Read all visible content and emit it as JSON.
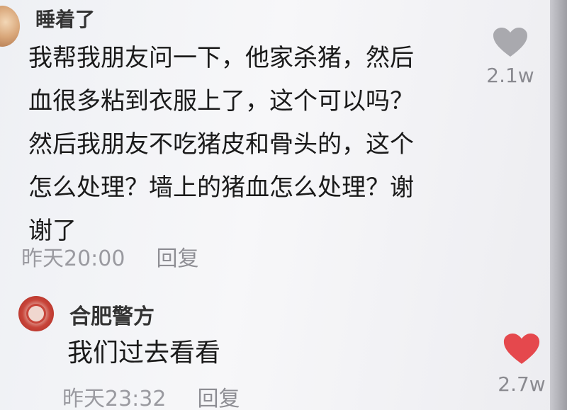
{
  "comments": [
    {
      "username": "睡着了",
      "text": "我帮我朋友问一下，他家杀猪，然后\n血很多粘到衣服上了，这个可以吗？\n然后我朋友不吃猪皮和骨头的，这个\n怎么处理？墙上的猪血怎么处理？谢\n谢了",
      "time": "昨天20:00",
      "reply_label": "回复",
      "likes": "2.1w",
      "liked": false,
      "heart_color": "#a9a9ae",
      "heart_icon": "heart-outline-gray"
    },
    {
      "username": "合肥警方",
      "text": "我们过去看看",
      "time": "昨天23:32",
      "reply_label": "回复",
      "likes": "2.7w",
      "liked": true,
      "heart_color": "#e5484d",
      "heart_icon": "heart-filled-red"
    }
  ]
}
